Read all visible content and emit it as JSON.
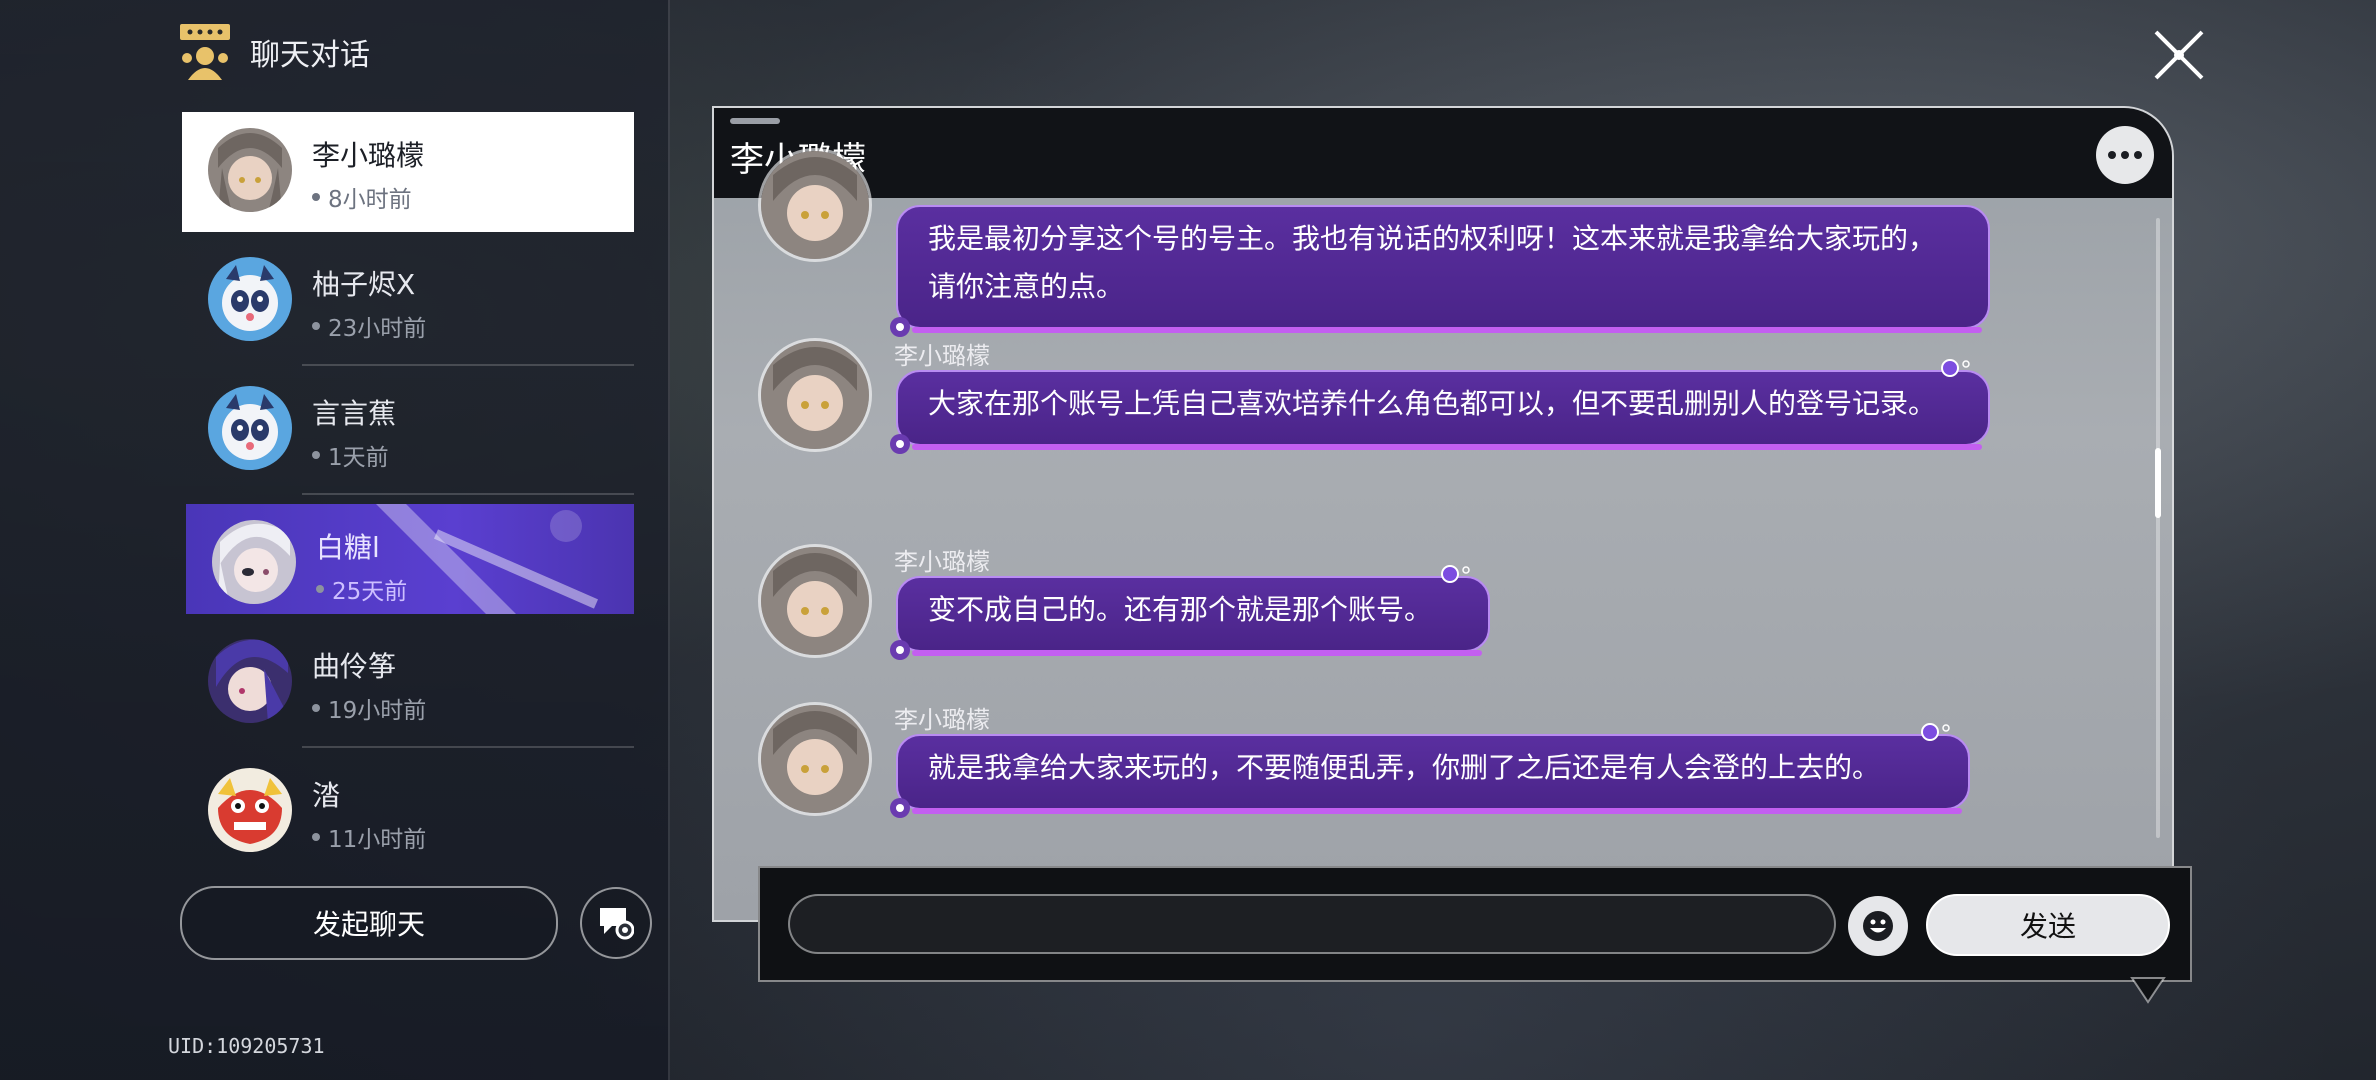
{
  "header": {
    "title": "聊天对话"
  },
  "contacts": [
    {
      "name": "李小璐檬",
      "time": "8小时前"
    },
    {
      "name": "柚子烬X",
      "time": "23小时前"
    },
    {
      "name": "言言蕉",
      "time": "1天前"
    },
    {
      "name": "白糖l",
      "time": "25天前"
    },
    {
      "name": "曲伶筝",
      "time": "19小时前"
    },
    {
      "name": "涾",
      "time": "11小时前"
    }
  ],
  "actions": {
    "start_chat": "发起聊天"
  },
  "uid": "UID:109205731",
  "chat": {
    "title": "李小璐檬",
    "messages": [
      {
        "sender": "",
        "text": "我是最初分享这个号的号主。我也有说话的权利呀！这本来就是我拿给大家玩的，请你注意的点。"
      },
      {
        "sender": "李小璐檬",
        "text": "大家在那个账号上凭自己喜欢培养什么角色都可以，但不要乱删别人的登号记录。"
      },
      {
        "sender": "李小璐檬",
        "text": "变不成自己的。还有那个就是那个账号。"
      },
      {
        "sender": "李小璐檬",
        "text": "就是我拿给大家来玩的，不要随便乱弄，你删了之后还是有人会登的上去的。"
      }
    ]
  },
  "input": {
    "placeholder": "",
    "send_label": "发送"
  },
  "colors": {
    "bubble": "#4a2488",
    "bubble_border": "#b98cf2",
    "highlight": "#5a3fd0"
  }
}
